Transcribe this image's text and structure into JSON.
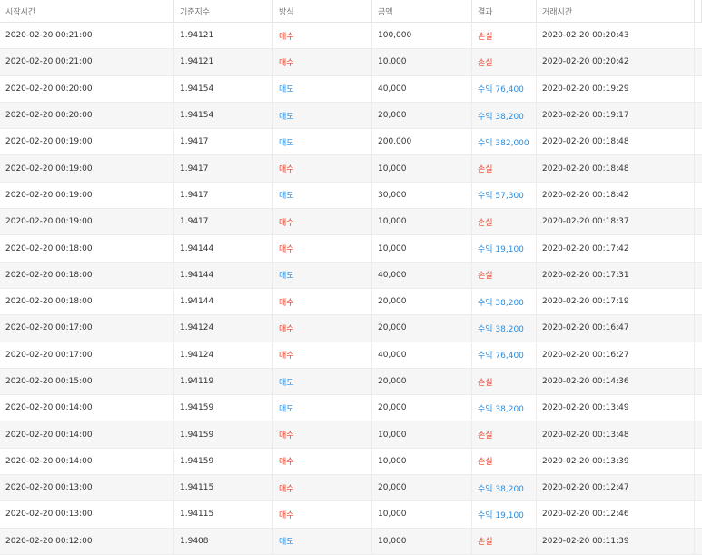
{
  "table": {
    "headers": {
      "start_time": "시작시간",
      "index_value": "기준지수",
      "method": "방식",
      "amount": "금액",
      "result": "결과",
      "trade_time": "거래시간"
    },
    "colors": {
      "buy": "#e8412b",
      "sell": "#2a8ee0",
      "loss": "#e8412b",
      "profit": "#2a8ee0"
    },
    "rows": [
      {
        "start": "2020-02-20 00:21:00",
        "index": "1.94121",
        "method": "매수",
        "method_type": "buy",
        "amount": "100,000",
        "result": "손실",
        "result_type": "loss",
        "trade": "2020-02-20 00:20:43"
      },
      {
        "start": "2020-02-20 00:21:00",
        "index": "1.94121",
        "method": "매수",
        "method_type": "buy",
        "amount": "10,000",
        "result": "손실",
        "result_type": "loss",
        "trade": "2020-02-20 00:20:42"
      },
      {
        "start": "2020-02-20 00:20:00",
        "index": "1.94154",
        "method": "매도",
        "method_type": "sell",
        "amount": "40,000",
        "result": "수익 76,400",
        "result_type": "profit",
        "trade": "2020-02-20 00:19:29"
      },
      {
        "start": "2020-02-20 00:20:00",
        "index": "1.94154",
        "method": "매도",
        "method_type": "sell",
        "amount": "20,000",
        "result": "수익 38,200",
        "result_type": "profit",
        "trade": "2020-02-20 00:19:17"
      },
      {
        "start": "2020-02-20 00:19:00",
        "index": "1.9417",
        "method": "매도",
        "method_type": "sell",
        "amount": "200,000",
        "result": "수익 382,000",
        "result_type": "profit",
        "trade": "2020-02-20 00:18:48"
      },
      {
        "start": "2020-02-20 00:19:00",
        "index": "1.9417",
        "method": "매수",
        "method_type": "buy",
        "amount": "10,000",
        "result": "손실",
        "result_type": "loss",
        "trade": "2020-02-20 00:18:48"
      },
      {
        "start": "2020-02-20 00:19:00",
        "index": "1.9417",
        "method": "매도",
        "method_type": "sell",
        "amount": "30,000",
        "result": "수익 57,300",
        "result_type": "profit",
        "trade": "2020-02-20 00:18:42"
      },
      {
        "start": "2020-02-20 00:19:00",
        "index": "1.9417",
        "method": "매수",
        "method_type": "buy",
        "amount": "10,000",
        "result": "손실",
        "result_type": "loss",
        "trade": "2020-02-20 00:18:37"
      },
      {
        "start": "2020-02-20 00:18:00",
        "index": "1.94144",
        "method": "매수",
        "method_type": "buy",
        "amount": "10,000",
        "result": "수익 19,100",
        "result_type": "profit",
        "trade": "2020-02-20 00:17:42"
      },
      {
        "start": "2020-02-20 00:18:00",
        "index": "1.94144",
        "method": "매도",
        "method_type": "sell",
        "amount": "40,000",
        "result": "손실",
        "result_type": "loss",
        "trade": "2020-02-20 00:17:31"
      },
      {
        "start": "2020-02-20 00:18:00",
        "index": "1.94144",
        "method": "매수",
        "method_type": "buy",
        "amount": "20,000",
        "result": "수익 38,200",
        "result_type": "profit",
        "trade": "2020-02-20 00:17:19"
      },
      {
        "start": "2020-02-20 00:17:00",
        "index": "1.94124",
        "method": "매수",
        "method_type": "buy",
        "amount": "20,000",
        "result": "수익 38,200",
        "result_type": "profit",
        "trade": "2020-02-20 00:16:47"
      },
      {
        "start": "2020-02-20 00:17:00",
        "index": "1.94124",
        "method": "매수",
        "method_type": "buy",
        "amount": "40,000",
        "result": "수익 76,400",
        "result_type": "profit",
        "trade": "2020-02-20 00:16:27"
      },
      {
        "start": "2020-02-20 00:15:00",
        "index": "1.94119",
        "method": "매도",
        "method_type": "sell",
        "amount": "20,000",
        "result": "손실",
        "result_type": "loss",
        "trade": "2020-02-20 00:14:36"
      },
      {
        "start": "2020-02-20 00:14:00",
        "index": "1.94159",
        "method": "매도",
        "method_type": "sell",
        "amount": "20,000",
        "result": "수익 38,200",
        "result_type": "profit",
        "trade": "2020-02-20 00:13:49"
      },
      {
        "start": "2020-02-20 00:14:00",
        "index": "1.94159",
        "method": "매수",
        "method_type": "buy",
        "amount": "10,000",
        "result": "손실",
        "result_type": "loss",
        "trade": "2020-02-20 00:13:48"
      },
      {
        "start": "2020-02-20 00:14:00",
        "index": "1.94159",
        "method": "매수",
        "method_type": "buy",
        "amount": "10,000",
        "result": "손실",
        "result_type": "loss",
        "trade": "2020-02-20 00:13:39"
      },
      {
        "start": "2020-02-20 00:13:00",
        "index": "1.94115",
        "method": "매수",
        "method_type": "buy",
        "amount": "20,000",
        "result": "수익 38,200",
        "result_type": "profit",
        "trade": "2020-02-20 00:12:47"
      },
      {
        "start": "2020-02-20 00:13:00",
        "index": "1.94115",
        "method": "매수",
        "method_type": "buy",
        "amount": "10,000",
        "result": "수익 19,100",
        "result_type": "profit",
        "trade": "2020-02-20 00:12:46"
      },
      {
        "start": "2020-02-20 00:12:00",
        "index": "1.9408",
        "method": "매도",
        "method_type": "sell",
        "amount": "10,000",
        "result": "손실",
        "result_type": "loss",
        "trade": "2020-02-20 00:11:39"
      }
    ]
  }
}
